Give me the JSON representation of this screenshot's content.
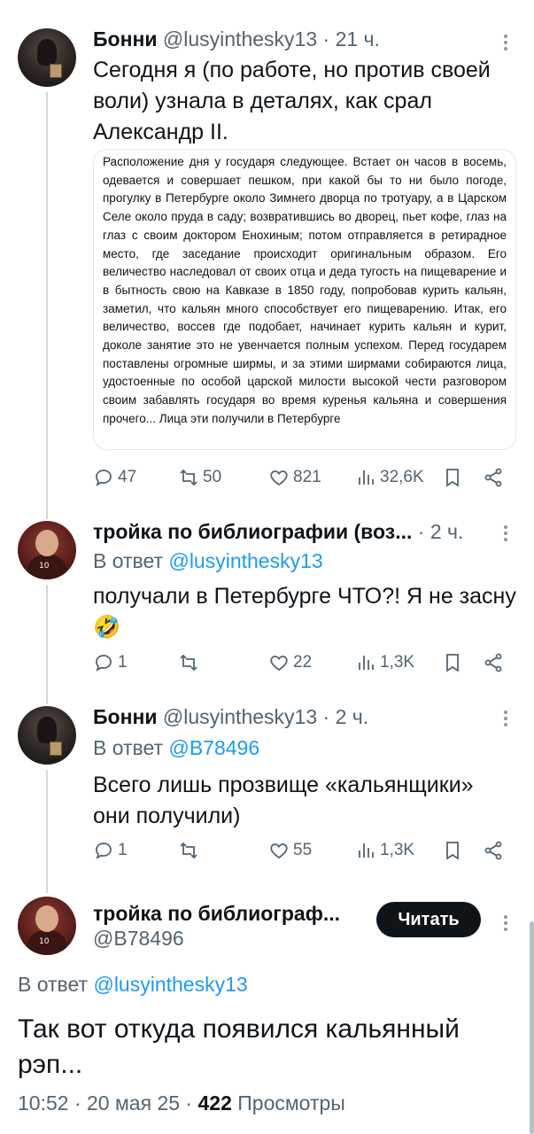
{
  "tweets": [
    {
      "author": "Бонни",
      "handle": "@lusyinthesky13",
      "sep": "·",
      "time": "21 ч.",
      "text": "Сегодня я (по работе, но против своей воли) узнала в деталях, как срал Александр II.",
      "image_text": "Расположение дня у государя следующее. Встает он часов в восемь, одевается и совершает пешком, при какой бы то ни было погоде, прогулку в Петербурге около Зимнего дворца по тротуару, а в Царском Селе около пруда в саду; возвратившись во дворец, пьет кофе, глаз на глаз с своим доктором Енохиным; потом отправляется в ретирадное место, где заседание происходит оригинальным образом. Его величество наследовал от своих отца и деда тугость на пищеварение и в бытность свою на Кавказе в 1850 году, попробовав курить кальян, заметил, что кальян много способствует его пищеварению. Итак, его величество, воссев где подобает, начинает курить кальян и курит, доколе занятие это не увенчается полным успехом. Перед государем поставлены огромные ширмы, и за этими ширмами собираются лица, удостоенные по особой царской милости высокой чести разговором своим забавлять государя во время куренья кальяна и совершения прочего...  Лица эти получили в Петербурге",
      "replies": "47",
      "retweets": "50",
      "likes": "821",
      "views": "32,6K"
    },
    {
      "author": "тройка по библиографии (воз...",
      "handle": "",
      "sep": "·",
      "time": "2 ч.",
      "reply_prefix": "В ответ",
      "reply_to": "@lusyinthesky13",
      "text": "получали в Петербурге ЧТО?! Я не засну 🤣",
      "replies": "1",
      "retweets": "",
      "likes": "22",
      "views": "1,3K"
    },
    {
      "author": "Бонни",
      "handle": "@lusyinthesky13",
      "sep": "·",
      "time": "2 ч.",
      "reply_prefix": "В ответ",
      "reply_to": "@B78496",
      "text": "Всего лишь прозвище «кальянщики» они получили)",
      "replies": "1",
      "retweets": "",
      "likes": "55",
      "views": "1,3K"
    }
  ],
  "main_tweet": {
    "author": "тройка по библиограф...",
    "handle": "@B78496",
    "follow_label": "Читать",
    "reply_prefix": "В ответ",
    "reply_to": "@lusyinthesky13",
    "text": "Так вот откуда появился кальянный рэп...",
    "time": "10:52",
    "date": "20 мая 25",
    "sep": "·",
    "views_count": "422",
    "views_label": "Просмотры"
  },
  "icons": {
    "reply": "reply-icon",
    "retweet": "retweet-icon",
    "like": "heart-icon",
    "views": "views-chart-icon",
    "bookmark": "bookmark-icon",
    "share": "share-icon",
    "more": "more-vertical-icon"
  },
  "colors": {
    "accent": "#1d9bf0",
    "text": "#0f1419",
    "muted": "#536471",
    "button": "#0f1419"
  }
}
